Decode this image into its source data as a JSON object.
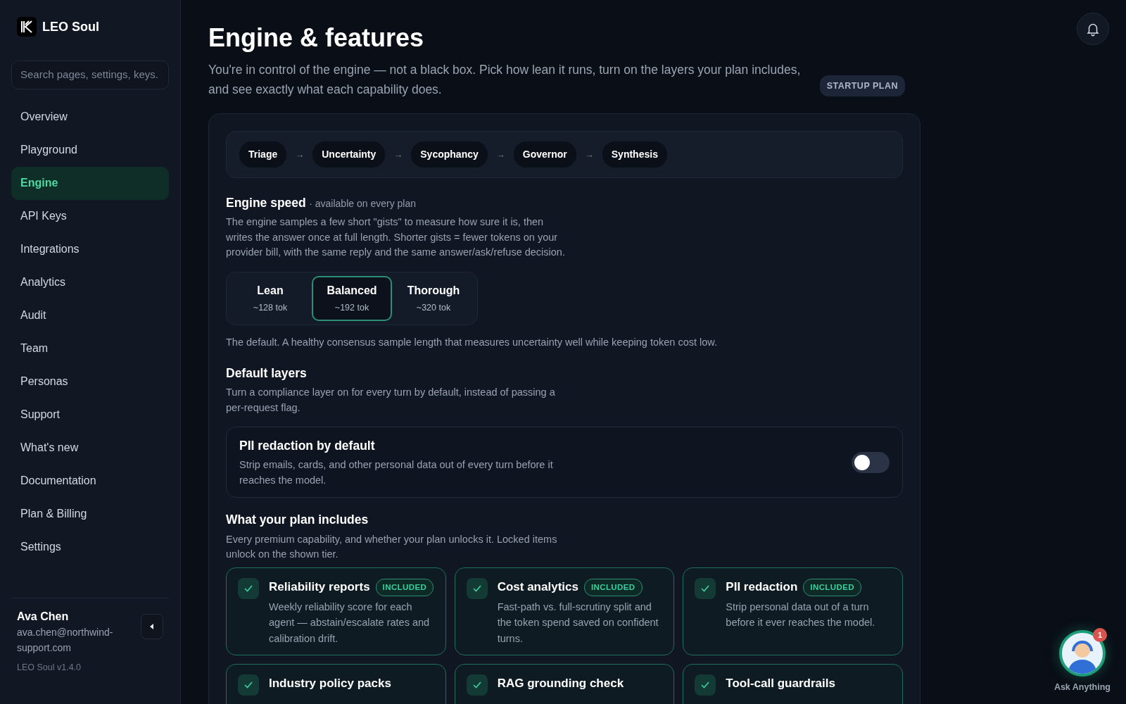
{
  "sidebar": {
    "brand": "LEO Soul",
    "search": {
      "placeholder": "Search pages, settings, keys."
    },
    "items": [
      {
        "label": "Overview",
        "selected": false
      },
      {
        "label": "Playground",
        "selected": false
      },
      {
        "label": "Engine",
        "selected": true
      },
      {
        "label": "API Keys",
        "selected": false
      },
      {
        "label": "Integrations",
        "selected": false
      },
      {
        "label": "Analytics",
        "selected": false
      },
      {
        "label": "Audit",
        "selected": false
      },
      {
        "label": "Team",
        "selected": false
      },
      {
        "label": "Personas",
        "selected": false
      },
      {
        "label": "Support",
        "selected": false
      },
      {
        "label": "What's new",
        "selected": false
      },
      {
        "label": "Documentation",
        "selected": false
      },
      {
        "label": "Plan & Billing",
        "selected": false
      },
      {
        "label": "Settings",
        "selected": false
      }
    ],
    "user": {
      "name": "Ava Chen",
      "email": "ava.chen@northwind-support.com",
      "version": "LEO Soul v1.4.0"
    }
  },
  "header": {
    "title": "Engine & features",
    "description": "You're in control of the engine — not a black box. Pick how lean it runs, turn on the layers your plan includes, and see exactly what each capability does.",
    "plan_badge": "STARTUP PLAN"
  },
  "pipeline": {
    "separator": "→",
    "stages": [
      "Triage",
      "Uncertainty",
      "Sycophancy",
      "Governor",
      "Synthesis"
    ]
  },
  "engine_speed": {
    "title": "Engine speed",
    "note": "· available on every plan",
    "description": "The engine samples a few short \"gists\" to measure how sure it is, then writes the answer once at full length. Shorter gists = fewer tokens on your provider bill, with the same reply and the same answer/ask/refuse decision.",
    "options": [
      {
        "label": "Lean",
        "tokens": "~128 tok",
        "selected": false
      },
      {
        "label": "Balanced",
        "tokens": "~192 tok",
        "selected": true
      },
      {
        "label": "Thorough",
        "tokens": "~320 tok",
        "selected": false
      }
    ],
    "selected_description": "The default. A healthy consensus sample length that measures uncertainty well while keeping token cost low."
  },
  "default_layers": {
    "title": "Default layers",
    "description": "Turn a compliance layer on for every turn by default, instead of passing a per-request flag.",
    "toggles": [
      {
        "title": "PII redaction by default",
        "description": "Strip emails, cards, and other personal data out of every turn before it reaches the model.",
        "on": false
      }
    ]
  },
  "plan": {
    "title": "What your plan includes",
    "description": "Every premium capability, and whether your plan unlocks it. Locked items unlock on the shown tier.",
    "features": [
      {
        "title": "Reliability reports",
        "badge": "INCLUDED",
        "included": true,
        "description": "Weekly reliability score for each agent — abstain/escalate rates and calibration drift."
      },
      {
        "title": "Cost analytics",
        "badge": "INCLUDED",
        "included": true,
        "description": "Fast-path vs. full-scrutiny split and the token spend saved on confident turns."
      },
      {
        "title": "PII redaction",
        "badge": "INCLUDED",
        "included": true,
        "description": "Strip personal data out of a turn before it ever reaches the model."
      },
      {
        "title": "Industry policy packs",
        "included": true
      },
      {
        "title": "RAG grounding check",
        "included": true
      },
      {
        "title": "Tool-call guardrails",
        "included": true
      }
    ]
  },
  "assistant": {
    "label": "Ask Anything",
    "badge": "1"
  }
}
